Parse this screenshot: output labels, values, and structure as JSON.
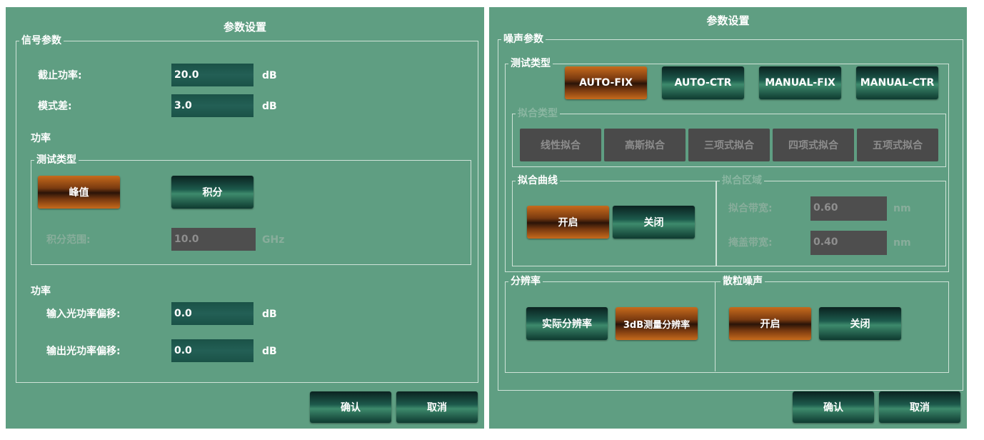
{
  "left": {
    "title": "参数设置",
    "signal_group": "信号参数",
    "cutoff_label": "截止功率:",
    "cutoff_value": "20.0",
    "cutoff_unit": "dB",
    "mode_label": "模式差:",
    "mode_value": "3.0",
    "mode_unit": "dB",
    "power_label_1": "功率",
    "test_group": "测试类型",
    "peak_btn": "峰值",
    "integral_btn": "积分",
    "range_label": "积分范围:",
    "range_value": "10.0",
    "range_unit": "GHz",
    "power_label_2": "功率",
    "in_offset_label": "输入光功率偏移:",
    "in_offset_value": "0.0",
    "in_offset_unit": "dB",
    "out_offset_label": "输出光功率偏移:",
    "out_offset_value": "0.0",
    "out_offset_unit": "dB",
    "ok": "确认",
    "cancel": "取消"
  },
  "right": {
    "title": "参数设置",
    "noise_group": "噪声参数",
    "test_group": "测试类型",
    "test_buttons": [
      "AUTO-FIX",
      "AUTO-CTR",
      "MANUAL-FIX",
      "MANUAL-CTR"
    ],
    "fit_type_group": "拟合类型",
    "fit_buttons": [
      "线性拟合",
      "高斯拟合",
      "三项式拟合",
      "四项式拟合",
      "五项式拟合"
    ],
    "curve_group": "拟合曲线",
    "curve_on": "开启",
    "curve_off": "关闭",
    "region_group": "拟合区域",
    "fit_bw_label": "拟合带宽:",
    "fit_bw_value": "0.60",
    "fit_bw_unit": "nm",
    "mask_bw_label": "掩盖带宽:",
    "mask_bw_value": "0.40",
    "mask_bw_unit": "nm",
    "resolution_group": "分辨率",
    "res_actual": "实际分辨率",
    "res_3db": "3dB测量分辨率",
    "shot_group": "散粒噪声",
    "shot_on": "开启",
    "shot_off": "关闭",
    "ok": "确认",
    "cancel": "取消"
  },
  "colors": {
    "panel": "#5f9e82",
    "button_green": "#1d5a4c",
    "button_orange": "#c76b1c",
    "disabled": "#4a4a4a"
  }
}
